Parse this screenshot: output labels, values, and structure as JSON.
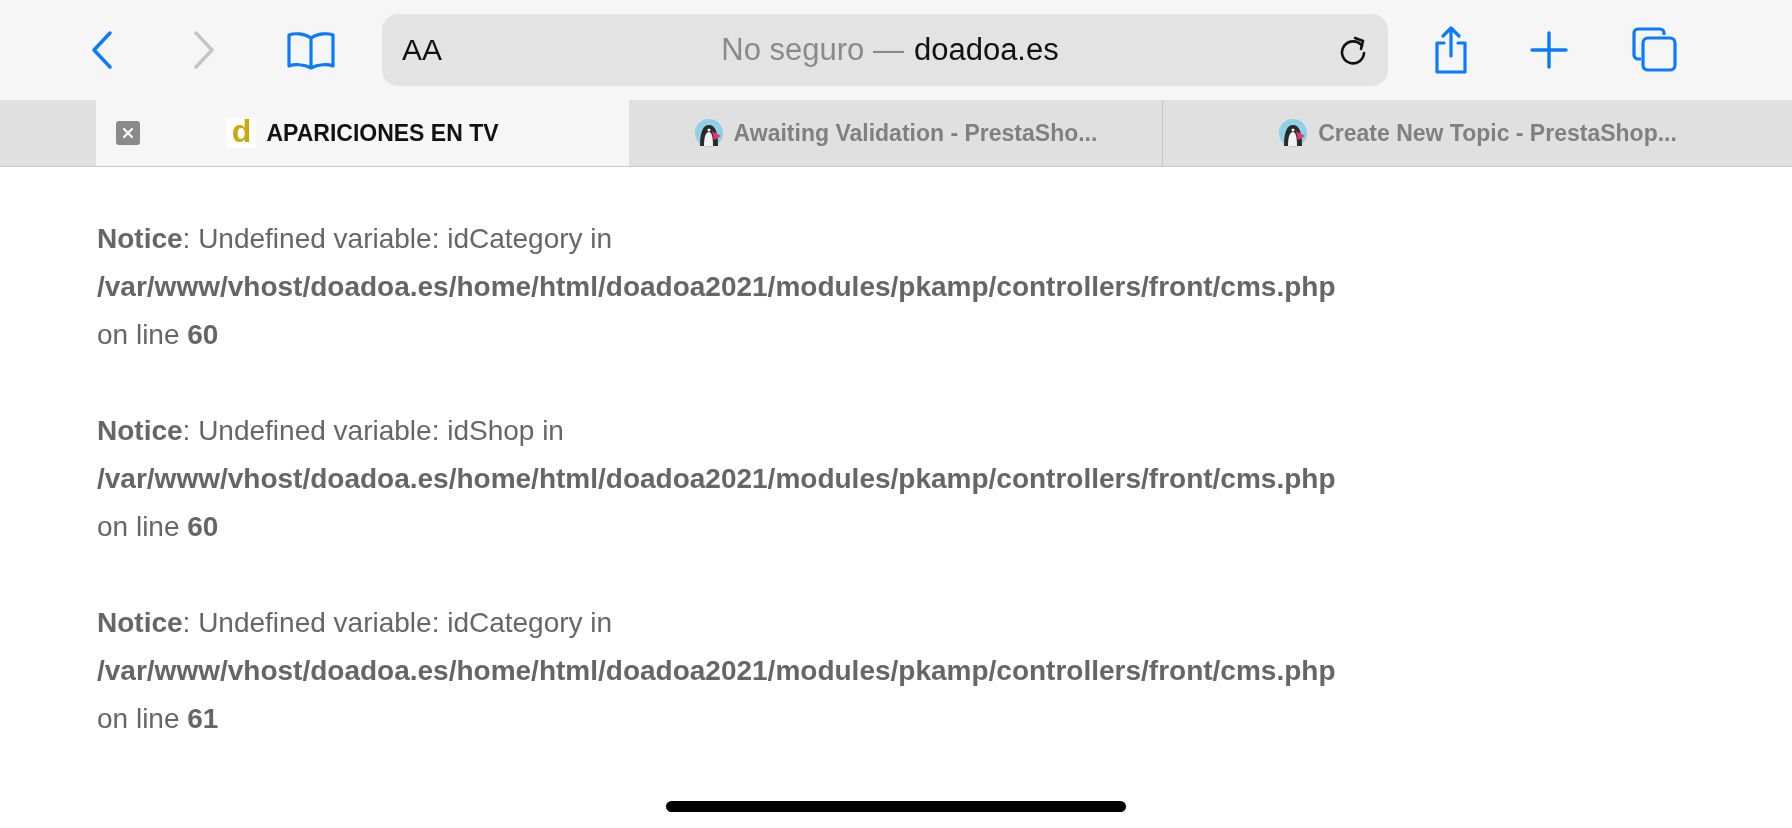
{
  "toolbar": {
    "back_disabled": false,
    "forward_disabled": true,
    "text_size_label": "AA",
    "address": {
      "security": "No seguro —",
      "domain": "doadoa.es"
    }
  },
  "tabs": [
    {
      "title": "APARICIONES EN TV",
      "selected": true,
      "favicon": {
        "kind": "letter",
        "text": "d"
      }
    },
    {
      "title": "Awaiting Validation - PrestaSho...",
      "selected": false,
      "favicon": {
        "kind": "bird"
      }
    },
    {
      "title": "Create New Topic - PrestaShop...",
      "selected": false,
      "favicon": {
        "kind": "bird"
      }
    }
  ],
  "notices": [
    {
      "message": "**Notice**: Undefined variable: idCategory in",
      "path": "/var/www/vhost/doadoa.es/home/html/doadoa2021/modules/pkamp/controllers/front/cms.php",
      "line": "on line **60**"
    },
    {
      "message": "**Notice**: Undefined variable: idShop in",
      "path": "/var/www/vhost/doadoa.es/home/html/doadoa2021/modules/pkamp/controllers/front/cms.php",
      "line": "on line **60**"
    },
    {
      "message": "**Notice**: Undefined variable: idCategory in",
      "path": "/var/www/vhost/doadoa.es/home/html/doadoa2021/modules/pkamp/controllers/front/cms.php",
      "line": "on line **61**"
    }
  ]
}
